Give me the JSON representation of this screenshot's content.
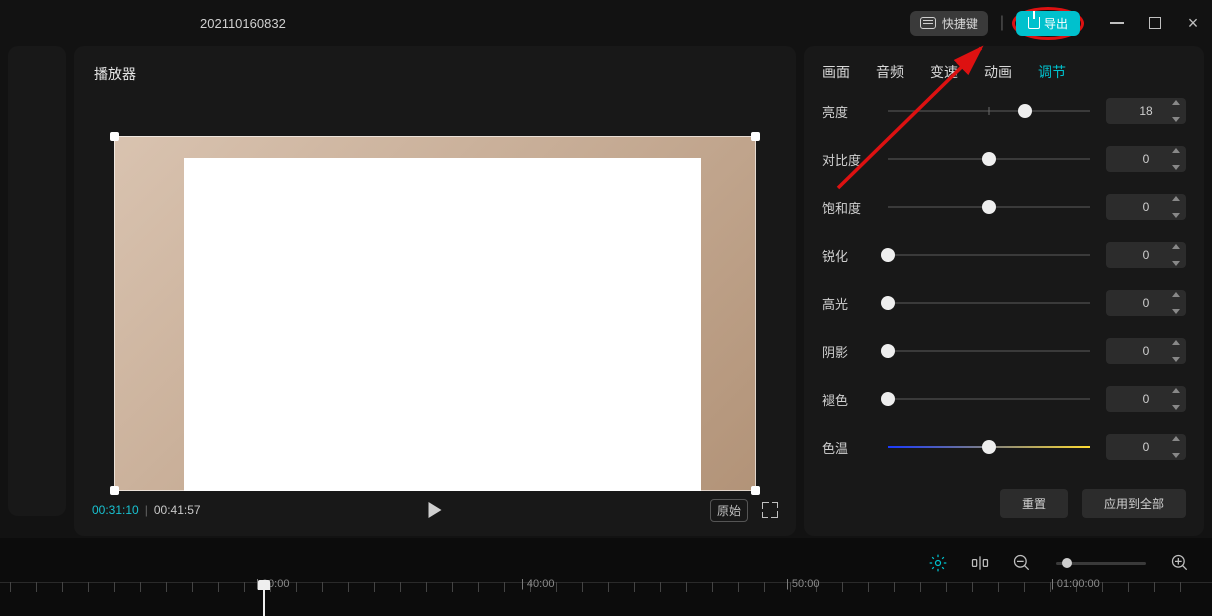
{
  "titlebar": {
    "project_name": "202110160832",
    "shortcut_label": "快捷键",
    "export_label": "导出"
  },
  "player": {
    "panel_title": "播放器",
    "current_time": "00:31:10",
    "total_time": "00:41:57",
    "aspect_label": "原始"
  },
  "inspector": {
    "tabs": {
      "t0": "画面",
      "t1": "音频",
      "t2": "变速",
      "t3": "动画",
      "t4": "调节"
    },
    "params": {
      "brightness": {
        "label": "亮度",
        "value": 18,
        "pos": 68,
        "centered": true
      },
      "contrast": {
        "label": "对比度",
        "value": 0,
        "pos": 50,
        "centered": true
      },
      "saturation": {
        "label": "饱和度",
        "value": 0,
        "pos": 50,
        "centered": true
      },
      "sharpen": {
        "label": "锐化",
        "value": 0,
        "pos": 0,
        "centered": false
      },
      "highlight": {
        "label": "高光",
        "value": 0,
        "pos": 0,
        "centered": false
      },
      "shadow": {
        "label": "阴影",
        "value": 0,
        "pos": 0,
        "centered": false
      },
      "fade": {
        "label": "褪色",
        "value": 0,
        "pos": 0,
        "centered": false
      },
      "temperature": {
        "label": "色温",
        "value": 0,
        "pos": 50,
        "centered": true,
        "gradient": true
      }
    },
    "footer": {
      "reset": "重置",
      "apply_all": "应用到全部"
    }
  },
  "timeline": {
    "marks": {
      "m0": "30:00",
      "m1": "40:00",
      "m2": "50:00",
      "m3": "01:00:00"
    }
  }
}
